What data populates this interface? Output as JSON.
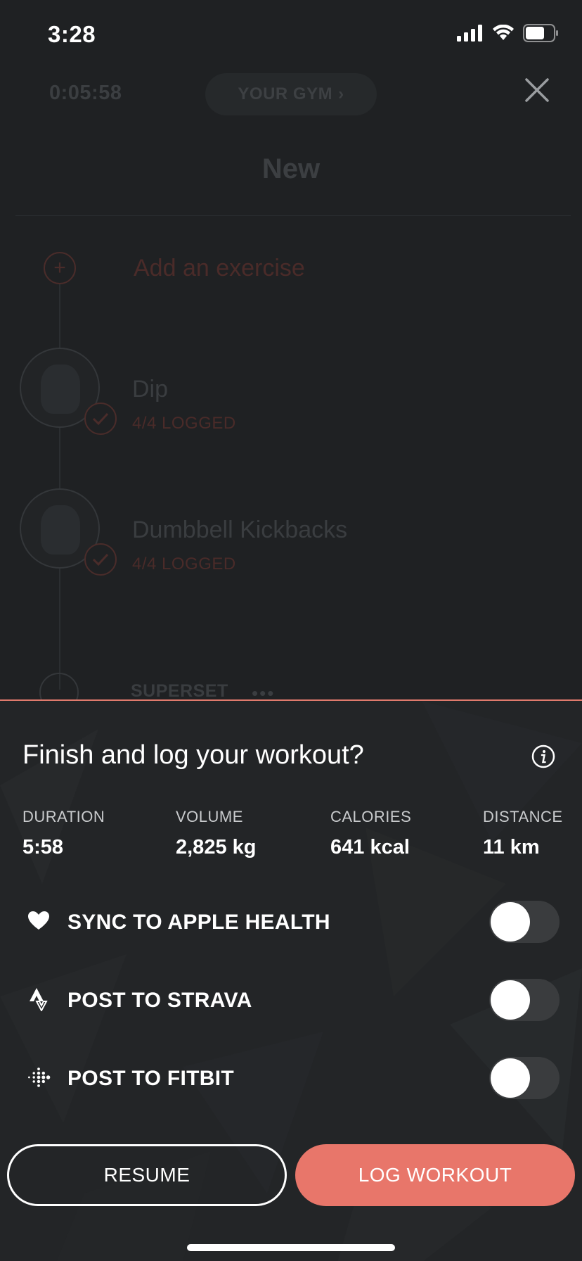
{
  "status_bar": {
    "time": "3:28"
  },
  "workout": {
    "timer": "0:05:58",
    "gym_label": "YOUR GYM",
    "title": "New",
    "add_exercise_label": "Add an exercise",
    "exercises": [
      {
        "name": "Dip",
        "status": "4/4 LOGGED"
      },
      {
        "name": "Dumbbell Kickbacks",
        "status": "4/4 LOGGED"
      }
    ],
    "superset_label": "SUPERSET"
  },
  "sheet": {
    "title": "Finish and log your workout?",
    "stats": [
      {
        "label": "DURATION",
        "value": "5:58"
      },
      {
        "label": "VOLUME",
        "value": "2,825 kg"
      },
      {
        "label": "CALORIES",
        "value": "641 kcal"
      },
      {
        "label": "DISTANCE",
        "value": "11 km"
      }
    ],
    "sync_options": [
      {
        "label": "SYNC TO APPLE HEALTH",
        "icon": "heart-icon",
        "enabled": false
      },
      {
        "label": "POST TO STRAVA",
        "icon": "strava-icon",
        "enabled": false
      },
      {
        "label": "POST TO FITBIT",
        "icon": "fitbit-icon",
        "enabled": false
      }
    ],
    "resume_label": "RESUME",
    "log_label": "LOG WORKOUT"
  },
  "colors": {
    "accent": "#e8766a",
    "sheet_background": "#232527",
    "toggle_off": "#3a3c3e"
  }
}
